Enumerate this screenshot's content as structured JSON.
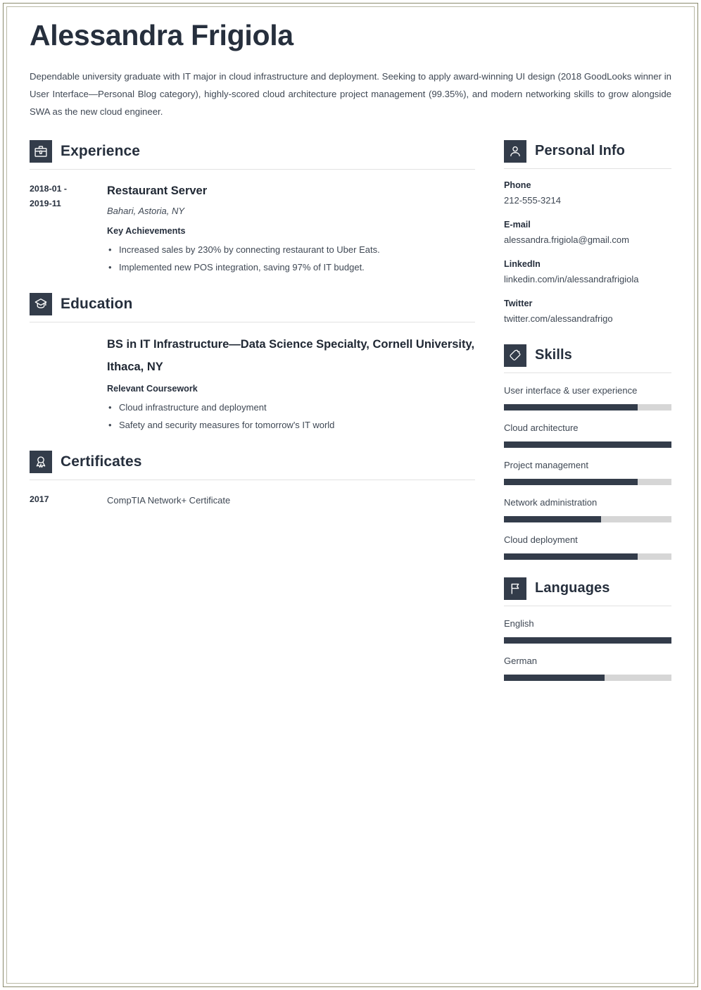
{
  "theme": {
    "accent_dark": "#333c4a",
    "heading_color": "#262f3d",
    "text_color": "#3f4854",
    "divider_color": "#e2e2e2",
    "bar_track_color": "#d6d6d6",
    "page_border_color": "#8a8a6e"
  },
  "header": {
    "name": "Alessandra Frigiola",
    "summary": "Dependable university graduate with IT major in cloud infrastructure and deployment. Seeking to apply award-winning UI design (2018 GoodLooks winner in User Interface—Personal Blog category), highly-scored cloud architecture project management (99.35%), and modern networking skills to grow alongside SWA as the new cloud engineer."
  },
  "main": {
    "experience": {
      "icon": "briefcase-icon",
      "title": "Experience",
      "entries": [
        {
          "date": "2018-01 - 2019-11",
          "date_line_1": "2018-01 -",
          "date_line_2": "2019-11",
          "job_title": "Restaurant Server",
          "company": "Bahari, Astoria, NY",
          "achievements_label": "Key Achievements",
          "bullets": [
            "Increased sales by 230% by connecting restaurant to Uber Eats.",
            "Implemented new POS integration, saving 97% of IT budget."
          ]
        }
      ]
    },
    "education": {
      "icon": "graduation-cap-icon",
      "title": "Education",
      "entries": [
        {
          "date": "",
          "degree": "BS in IT Infrastructure—Data Science Specialty, Cornell University, Ithaca, NY",
          "coursework_label": "Relevant Coursework",
          "bullets": [
            "Cloud infrastructure and deployment",
            "Safety and security measures for tomorrow's IT world"
          ]
        }
      ]
    },
    "certificates": {
      "icon": "award-ribbon-icon",
      "title": "Certificates",
      "entries": [
        {
          "date": "2017",
          "name": "CompTIA Network+ Certificate"
        }
      ]
    }
  },
  "sidebar": {
    "personal_info": {
      "icon": "person-icon",
      "title": "Personal Info",
      "fields": [
        {
          "label": "Phone",
          "value": "212-555-3214"
        },
        {
          "label": "E-mail",
          "value": "alessandra.frigiola@gmail.com"
        },
        {
          "label": "LinkedIn",
          "value": "linkedin.com/in/alessandrafrigiola"
        },
        {
          "label": "Twitter",
          "value": "twitter.com/alessandrafrigo"
        }
      ]
    },
    "skills": {
      "icon": "puzzle-piece-icon",
      "title": "Skills",
      "items": [
        {
          "label": "User interface & user experience",
          "level": 80
        },
        {
          "label": "Cloud architecture",
          "level": 100
        },
        {
          "label": "Project management",
          "level": 80
        },
        {
          "label": "Network administration",
          "level": 58
        },
        {
          "label": "Cloud deployment",
          "level": 80
        }
      ]
    },
    "languages": {
      "icon": "flag-icon",
      "title": "Languages",
      "items": [
        {
          "label": "English",
          "level": 100
        },
        {
          "label": "German",
          "level": 60
        }
      ]
    }
  }
}
